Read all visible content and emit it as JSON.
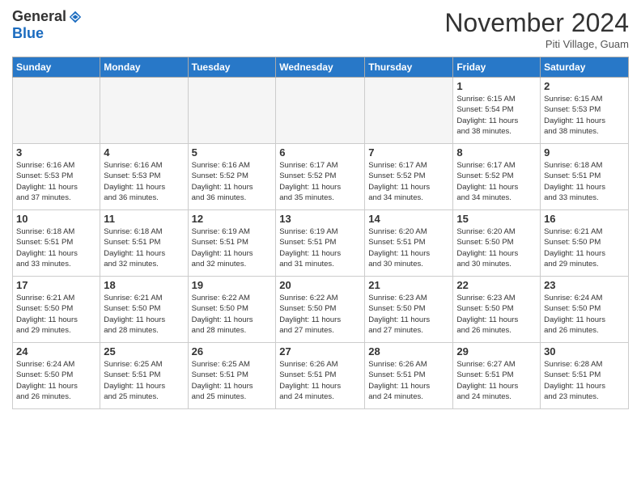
{
  "header": {
    "logo_general": "General",
    "logo_blue": "Blue",
    "month_year": "November 2024",
    "location": "Piti Village, Guam"
  },
  "days_of_week": [
    "Sunday",
    "Monday",
    "Tuesday",
    "Wednesday",
    "Thursday",
    "Friday",
    "Saturday"
  ],
  "weeks": [
    [
      {
        "day": "",
        "info": ""
      },
      {
        "day": "",
        "info": ""
      },
      {
        "day": "",
        "info": ""
      },
      {
        "day": "",
        "info": ""
      },
      {
        "day": "",
        "info": ""
      },
      {
        "day": "1",
        "info": "Sunrise: 6:15 AM\nSunset: 5:54 PM\nDaylight: 11 hours\nand 38 minutes."
      },
      {
        "day": "2",
        "info": "Sunrise: 6:15 AM\nSunset: 5:53 PM\nDaylight: 11 hours\nand 38 minutes."
      }
    ],
    [
      {
        "day": "3",
        "info": "Sunrise: 6:16 AM\nSunset: 5:53 PM\nDaylight: 11 hours\nand 37 minutes."
      },
      {
        "day": "4",
        "info": "Sunrise: 6:16 AM\nSunset: 5:53 PM\nDaylight: 11 hours\nand 36 minutes."
      },
      {
        "day": "5",
        "info": "Sunrise: 6:16 AM\nSunset: 5:52 PM\nDaylight: 11 hours\nand 36 minutes."
      },
      {
        "day": "6",
        "info": "Sunrise: 6:17 AM\nSunset: 5:52 PM\nDaylight: 11 hours\nand 35 minutes."
      },
      {
        "day": "7",
        "info": "Sunrise: 6:17 AM\nSunset: 5:52 PM\nDaylight: 11 hours\nand 34 minutes."
      },
      {
        "day": "8",
        "info": "Sunrise: 6:17 AM\nSunset: 5:52 PM\nDaylight: 11 hours\nand 34 minutes."
      },
      {
        "day": "9",
        "info": "Sunrise: 6:18 AM\nSunset: 5:51 PM\nDaylight: 11 hours\nand 33 minutes."
      }
    ],
    [
      {
        "day": "10",
        "info": "Sunrise: 6:18 AM\nSunset: 5:51 PM\nDaylight: 11 hours\nand 33 minutes."
      },
      {
        "day": "11",
        "info": "Sunrise: 6:18 AM\nSunset: 5:51 PM\nDaylight: 11 hours\nand 32 minutes."
      },
      {
        "day": "12",
        "info": "Sunrise: 6:19 AM\nSunset: 5:51 PM\nDaylight: 11 hours\nand 32 minutes."
      },
      {
        "day": "13",
        "info": "Sunrise: 6:19 AM\nSunset: 5:51 PM\nDaylight: 11 hours\nand 31 minutes."
      },
      {
        "day": "14",
        "info": "Sunrise: 6:20 AM\nSunset: 5:51 PM\nDaylight: 11 hours\nand 30 minutes."
      },
      {
        "day": "15",
        "info": "Sunrise: 6:20 AM\nSunset: 5:50 PM\nDaylight: 11 hours\nand 30 minutes."
      },
      {
        "day": "16",
        "info": "Sunrise: 6:21 AM\nSunset: 5:50 PM\nDaylight: 11 hours\nand 29 minutes."
      }
    ],
    [
      {
        "day": "17",
        "info": "Sunrise: 6:21 AM\nSunset: 5:50 PM\nDaylight: 11 hours\nand 29 minutes."
      },
      {
        "day": "18",
        "info": "Sunrise: 6:21 AM\nSunset: 5:50 PM\nDaylight: 11 hours\nand 28 minutes."
      },
      {
        "day": "19",
        "info": "Sunrise: 6:22 AM\nSunset: 5:50 PM\nDaylight: 11 hours\nand 28 minutes."
      },
      {
        "day": "20",
        "info": "Sunrise: 6:22 AM\nSunset: 5:50 PM\nDaylight: 11 hours\nand 27 minutes."
      },
      {
        "day": "21",
        "info": "Sunrise: 6:23 AM\nSunset: 5:50 PM\nDaylight: 11 hours\nand 27 minutes."
      },
      {
        "day": "22",
        "info": "Sunrise: 6:23 AM\nSunset: 5:50 PM\nDaylight: 11 hours\nand 26 minutes."
      },
      {
        "day": "23",
        "info": "Sunrise: 6:24 AM\nSunset: 5:50 PM\nDaylight: 11 hours\nand 26 minutes."
      }
    ],
    [
      {
        "day": "24",
        "info": "Sunrise: 6:24 AM\nSunset: 5:50 PM\nDaylight: 11 hours\nand 26 minutes."
      },
      {
        "day": "25",
        "info": "Sunrise: 6:25 AM\nSunset: 5:51 PM\nDaylight: 11 hours\nand 25 minutes."
      },
      {
        "day": "26",
        "info": "Sunrise: 6:25 AM\nSunset: 5:51 PM\nDaylight: 11 hours\nand 25 minutes."
      },
      {
        "day": "27",
        "info": "Sunrise: 6:26 AM\nSunset: 5:51 PM\nDaylight: 11 hours\nand 24 minutes."
      },
      {
        "day": "28",
        "info": "Sunrise: 6:26 AM\nSunset: 5:51 PM\nDaylight: 11 hours\nand 24 minutes."
      },
      {
        "day": "29",
        "info": "Sunrise: 6:27 AM\nSunset: 5:51 PM\nDaylight: 11 hours\nand 24 minutes."
      },
      {
        "day": "30",
        "info": "Sunrise: 6:28 AM\nSunset: 5:51 PM\nDaylight: 11 hours\nand 23 minutes."
      }
    ]
  ]
}
